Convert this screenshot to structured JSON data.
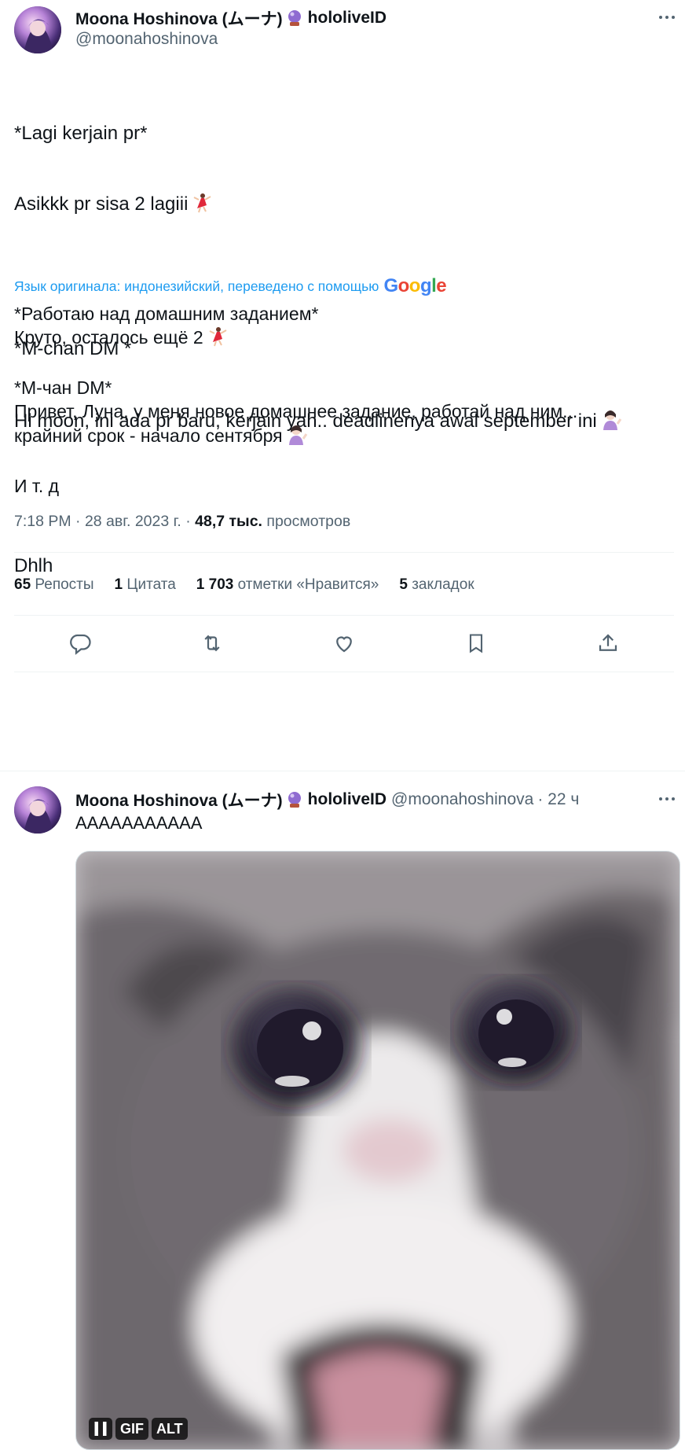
{
  "main_tweet": {
    "author": {
      "display_name": "Moona Hoshinova (ムーナ)",
      "affiliation": "hololiveID",
      "handle": "@moonahoshinova"
    },
    "text_lines": [
      "*Lagi kerjain pr*",
      "Asikkk pr sisa 2 lagiii",
      "",
      "*M-chan DM *",
      "Hi moon, ini ada pr baru, kerjain yah.. deadlinenya awal september ini",
      "",
      "Dhlh"
    ],
    "translation_note": "Язык оригинала: индонезийский, переведено с помощью",
    "translation_provider": "Google",
    "translated_lines": [
      "*Работаю над домашним заданием*",
      "Круто, осталось ещё 2",
      "",
      "*M-чан DM*",
      "Привет, Луна, у меня новое домашнее задание, работай над ним...",
      "крайний срок - начало сентября",
      "",
      "И т. д"
    ],
    "timestamp": "7:18 PM · 28 авг. 2023 г. ·",
    "views_count": "48,7 тыс.",
    "views_label": "просмотров",
    "stats": {
      "reposts_count": "65",
      "reposts_label": "Репосты",
      "quotes_count": "1",
      "quotes_label": "Цитата",
      "likes_count": "1 703",
      "likes_label": "отметки «Нравится»",
      "bookmarks_count": "5",
      "bookmarks_label": "закладок"
    },
    "actions": [
      "reply-icon",
      "repost-icon",
      "like-icon",
      "bookmark-icon",
      "share-icon"
    ]
  },
  "reply_tweet": {
    "author": {
      "display_name": "Moona Hoshinova (ムーナ)",
      "affiliation": "hololiveID",
      "handle": "@moonahoshinova",
      "time_ago": "· 22 ч"
    },
    "text": "AAAAAAAAAAA",
    "media_controls": {
      "gif_label": "GIF",
      "alt_label": "ALT"
    }
  },
  "colors": {
    "text_primary": "#0f1419",
    "text_secondary": "#536471",
    "accent_blue": "#1d9bf0",
    "divider": "#eff3f4"
  }
}
